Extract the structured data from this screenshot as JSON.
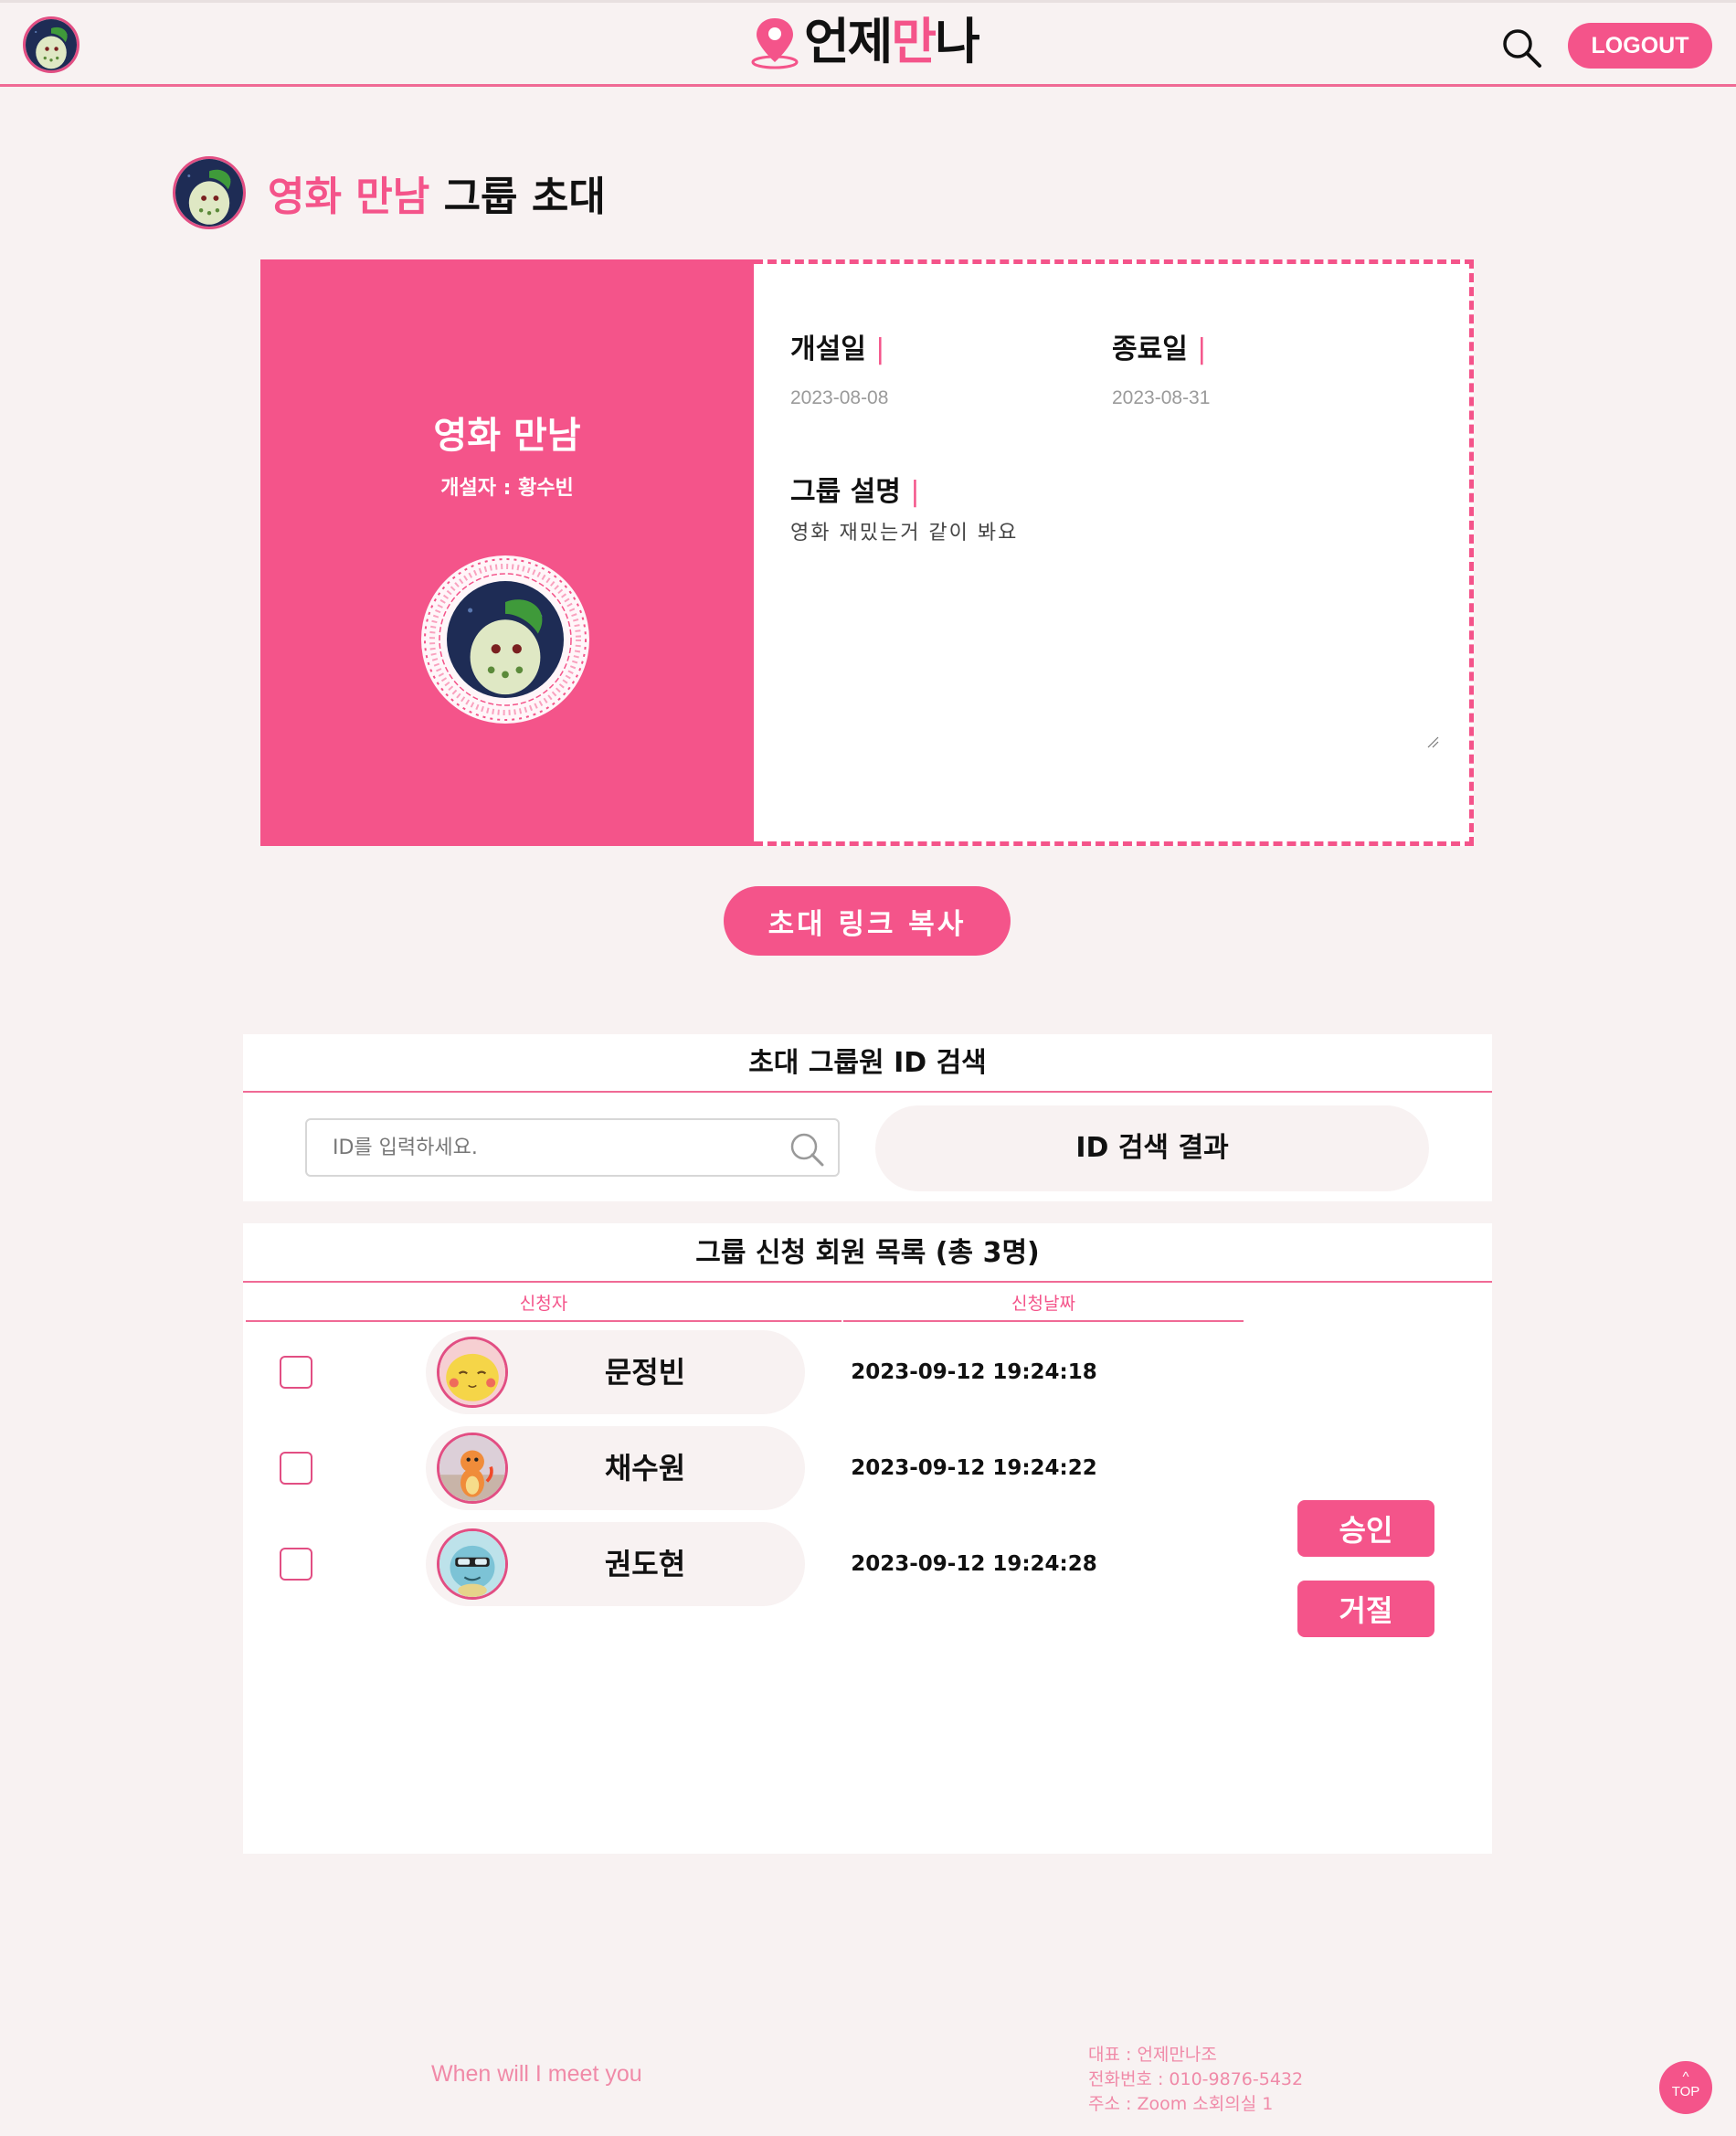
{
  "header": {
    "logo_part1": "언제",
    "logo_part2": "만",
    "logo_part3": "나",
    "logout_label": "LOGOUT",
    "icons": {
      "search": "search-icon",
      "pin": "location-pin-icon"
    }
  },
  "title": {
    "group_name": "영화 만남",
    "suffix": "그룹 초대"
  },
  "group_card": {
    "name": "영화 만남",
    "owner": "개설자 : 황수빈",
    "start_label": "개설일",
    "start_value": "2023-08-08",
    "end_label": "종료일",
    "end_value": "2023-08-31",
    "desc_label": "그룹 설명",
    "desc_value": "영화 재밌는거 같이 봐요",
    "bar": "|"
  },
  "copy_button": "초대 링크 복사",
  "search_panel": {
    "title": "초대 그룹원 ID 검색",
    "placeholder": "ID를 입력하세요.",
    "result_label": "ID 검색 결과"
  },
  "applicants": {
    "title": "그룹 신청 회원 목록 (총 3명)",
    "col_applicant": "신청자",
    "col_date": "신청날짜",
    "rows": [
      {
        "name": "문정빈",
        "date": "2023-09-12 19:24:18",
        "avatar": "pikachu-avatar"
      },
      {
        "name": "채수원",
        "date": "2023-09-12 19:24:22",
        "avatar": "charmander-avatar"
      },
      {
        "name": "권도현",
        "date": "2023-09-12 19:24:28",
        "avatar": "squirtle-avatar"
      }
    ],
    "approve_label": "승인",
    "reject_label": "거절"
  },
  "footer": {
    "slogan": "When will I meet you",
    "ceo": "대표 : 언제만나조",
    "phone": "전화번호 : 010-9876-5432",
    "address": "주소 : Zoom 소회의실 1",
    "top_arrow": "^",
    "top_label": "TOP"
  },
  "colors": {
    "accent": "#f4548a",
    "background": "#f8f2f2"
  }
}
